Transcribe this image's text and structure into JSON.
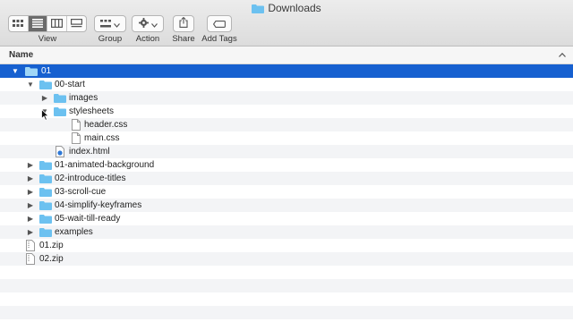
{
  "window": {
    "title": "Downloads"
  },
  "toolbar": {
    "view_label": "View",
    "group_label": "Group",
    "action_label": "Action",
    "share_label": "Share",
    "addtags_label": "Add Tags"
  },
  "columns": {
    "name_header": "Name"
  },
  "rows": [
    {
      "label": "01"
    },
    {
      "label": "00-start"
    },
    {
      "label": "images"
    },
    {
      "label": "stylesheets"
    },
    {
      "label": "header.css"
    },
    {
      "label": "main.css"
    },
    {
      "label": "index.html"
    },
    {
      "label": "01-animated-background"
    },
    {
      "label": "02-introduce-titles"
    },
    {
      "label": "03-scroll-cue"
    },
    {
      "label": "04-simplify-keyframes"
    },
    {
      "label": "05-wait-till-ready"
    },
    {
      "label": "examples"
    },
    {
      "label": "01.zip"
    },
    {
      "label": "02.zip"
    }
  ],
  "colors": {
    "selection": "#1660d0",
    "folder": "#6cc1f0"
  }
}
